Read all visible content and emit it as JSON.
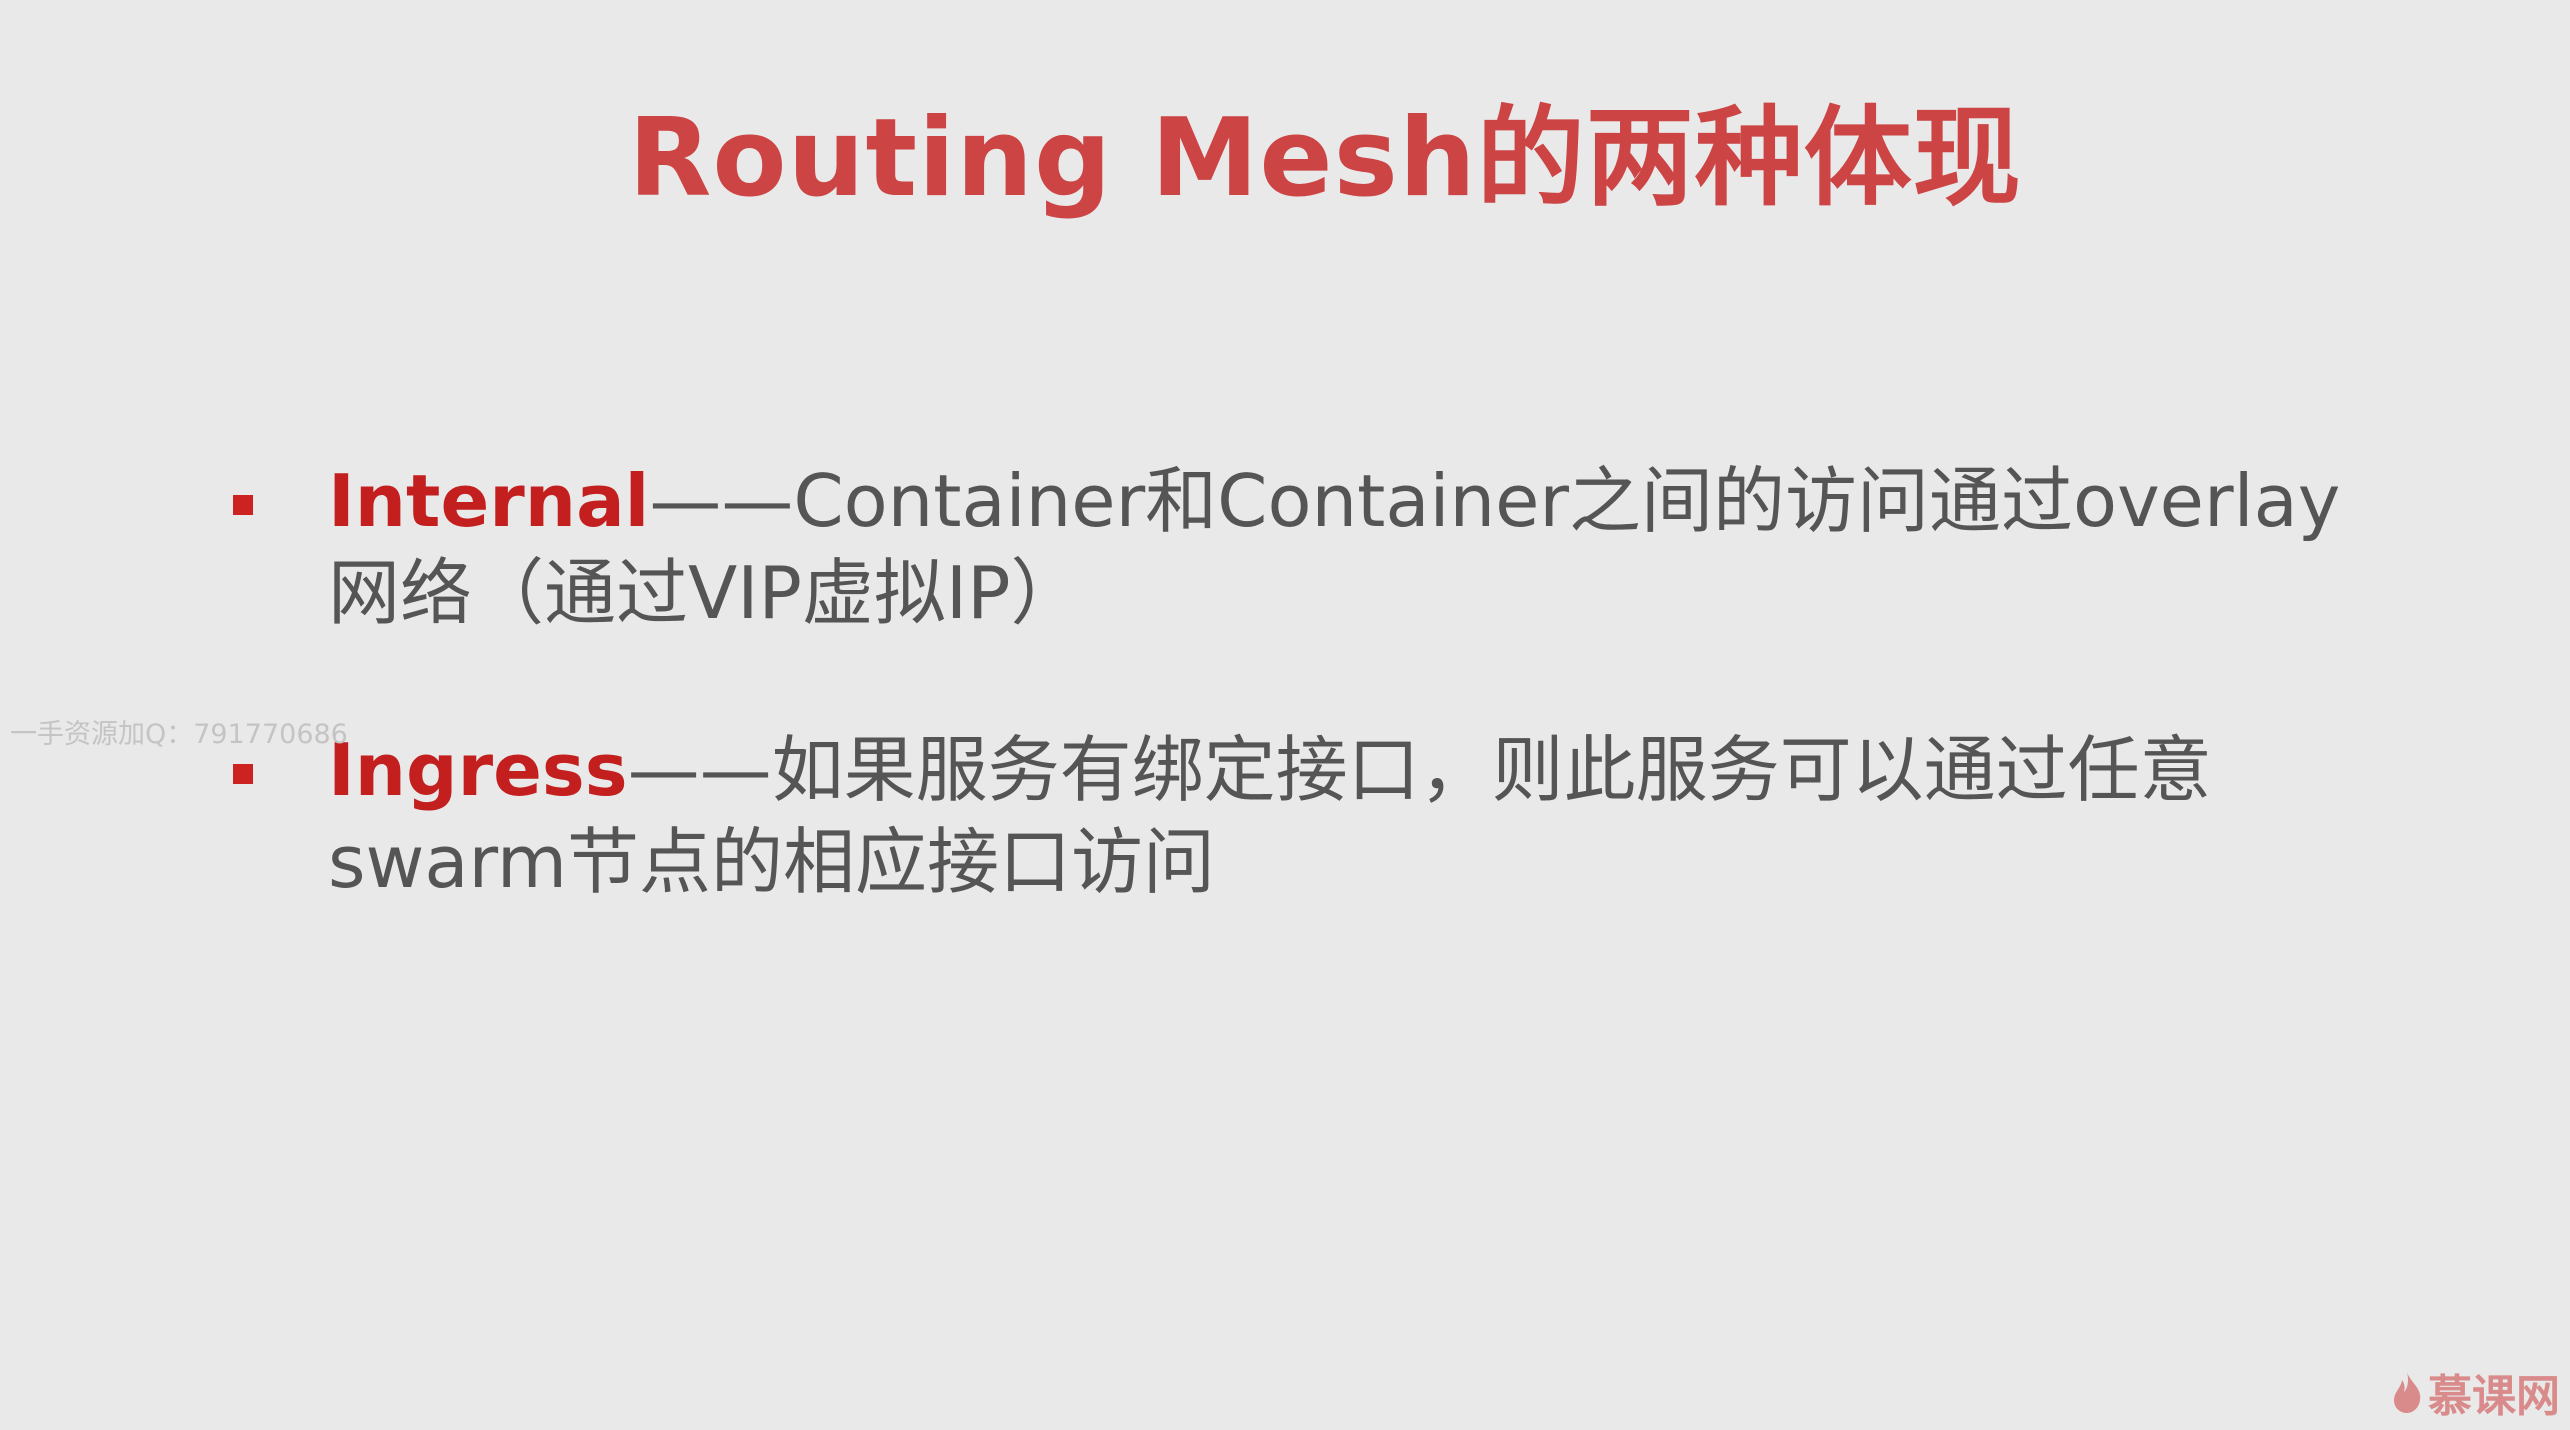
{
  "slide": {
    "title": "Routing Mesh的两种体现",
    "bullets": [
      {
        "term": "Internal",
        "text": "——Container和Container之间的访问通过overlay网络（通过VIP虚拟IP）"
      },
      {
        "term": "Ingress",
        "text": "——如果服务有绑定接口，则此服务可以通过任意swarm节点的相应接口访问"
      }
    ]
  },
  "watermark": "一手资源加Q：791770686",
  "logo": {
    "text": "慕课网",
    "icon": "flame-icon"
  },
  "colors": {
    "background": "#e9e9e9",
    "title": "#cc4444",
    "term": "#c41f1f",
    "body_text": "#555555",
    "bullet_marker": "#cc2222"
  }
}
